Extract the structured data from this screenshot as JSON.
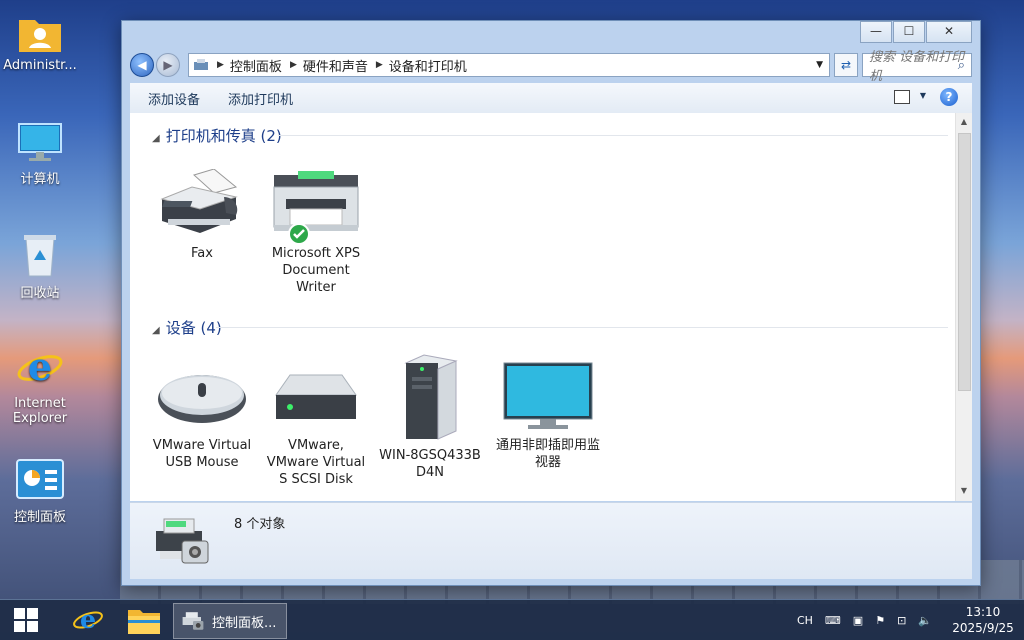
{
  "desktop": {
    "icons": [
      {
        "label": "Administr..."
      },
      {
        "label": "计算机"
      },
      {
        "label": "回收站"
      },
      {
        "label": "Internet Explorer"
      },
      {
        "label": "控制面板"
      }
    ]
  },
  "window": {
    "buttons": {
      "min": "—",
      "max": "☐",
      "close": "✕"
    },
    "address": {
      "crumbs": [
        "控制面板",
        "硬件和声音",
        "设备和打印机"
      ]
    },
    "search": {
      "placeholder": "搜索 设备和打印机"
    },
    "toolbar": {
      "add_device": "添加设备",
      "add_printer": "添加打印机",
      "help": "?"
    },
    "groups": [
      {
        "title": "打印机和传真 (2)",
        "items": [
          {
            "label": "Fax"
          },
          {
            "label": "Microsoft XPS Document Writer",
            "default": true
          }
        ]
      },
      {
        "title": "设备 (4)",
        "items": [
          {
            "label": "VMware Virtual USB Mouse"
          },
          {
            "label": "VMware, VMware Virtual S SCSI Disk"
          },
          {
            "label": "WIN-8GSQ433B D4N"
          },
          {
            "label": "通用非即插即用监视器"
          }
        ]
      }
    ],
    "details": {
      "count": "8 个对象"
    }
  },
  "taskbar": {
    "task_label": "控制面板...",
    "tray": {
      "lang": "CH",
      "time": "13:10",
      "date": "2025/9/25"
    }
  },
  "colors": {
    "accent": "#1e3f8a",
    "taskbar": "#1e2d46"
  }
}
